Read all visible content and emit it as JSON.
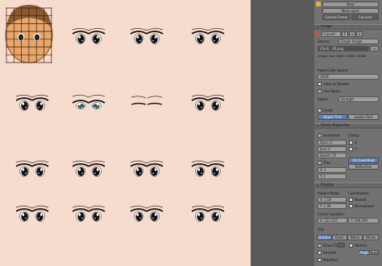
{
  "panel": {
    "new_label": "New",
    "new_layer_label": "New Layer",
    "cancel_frame_label": "Cancel Frame",
    "convert_label": "Convert",
    "image_header": "Image",
    "image_name": "CanvAi",
    "source_label": "Source:",
    "source_value": "Single Image",
    "filepath": "//facE...dfi.png",
    "image_info": "Image: size 1600 x 1600, RGBA",
    "color_space_label": "Input Color Space:",
    "color_space_value": "sRGB",
    "view_as_render_label": "View as Render",
    "use_alpha_label": "Use Alpha",
    "alpha_label": "Alpha:",
    "alpha_value": "Straight",
    "fields_label": "Fields",
    "upper_first_label": "Upper First",
    "lower_first_label": "Lower First",
    "game_props_header": "Game Properties",
    "animated_label": "Animated",
    "clamp_label": "Clamp:",
    "start_field": "Start:  0",
    "end_field": "End:  0",
    "speed_field": "Speed:  15",
    "clamp_x": "X",
    "clamp_y": "Y",
    "tiles_label": "Tiles",
    "uv_label": "UV Coordinat",
    "reflection_label": "Reflection",
    "tile_x": "X:  1",
    "tile_y": "Y:  1",
    "display_header": "Display",
    "aspect_label": "Aspect Ratio:",
    "coordinates_label": "Coordinates:",
    "aspect_x": "X:  1.00",
    "aspect_y": "Y:  1.00",
    "repeat_label": "Repeat",
    "normalized_label": "Normalized",
    "cursor_location_label": "Cursor Location:",
    "cursor_x": "X:  122.415",
    "cursor_y": "Y:  186.594",
    "uvs_label": "UVs",
    "outline_label": "Outline",
    "dash_label": "Dash",
    "black_label": "Black",
    "white_label": "White",
    "draw_faces_label": "Draw Fa",
    "stretch_label": "Stretch",
    "smooth_label": "Smooth",
    "angle_label": "Angle",
    "area_label": "Area",
    "modified_label": "Modified",
    "accent_color": "#5680c2"
  }
}
